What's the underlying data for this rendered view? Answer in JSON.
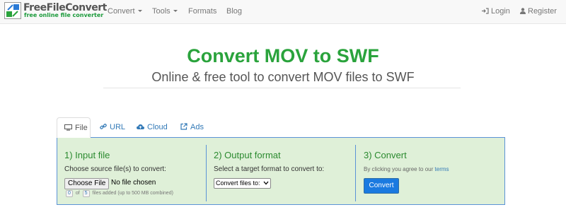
{
  "brand": {
    "name": "FreeFileConvert",
    "tagline": "free online file converter"
  },
  "nav": {
    "left": [
      "Convert",
      "Tools",
      "Formats",
      "Blog"
    ],
    "login": "Login",
    "register": "Register"
  },
  "hero": {
    "title": "Convert MOV to SWF",
    "subtitle": "Online & free tool to convert MOV files to SWF"
  },
  "tabs": [
    "File",
    "URL",
    "Cloud",
    "Ads"
  ],
  "steps": {
    "input": {
      "title": "1) Input file",
      "instruction": "Choose source file(s) to convert:",
      "choose_button": "Choose File",
      "no_file": "No file chosen",
      "files_added": "0",
      "files_limit": "5",
      "files_suffix": "files added (up to 500 MB combined)",
      "files_of": "of"
    },
    "output": {
      "title": "2) Output format",
      "instruction": "Select a target format to convert to:",
      "select_value": "Convert files to:"
    },
    "convert": {
      "title": "3) Convert",
      "agree_text": "By clicking you agree to our",
      "terms_link": "terms",
      "button": "Convert"
    }
  },
  "colors": {
    "accent_green": "#2aa33c",
    "panel_bg": "#dff0d8",
    "panel_border": "#5b93d6",
    "link_blue": "#337ab7",
    "button_blue": "#1a7ae0"
  }
}
